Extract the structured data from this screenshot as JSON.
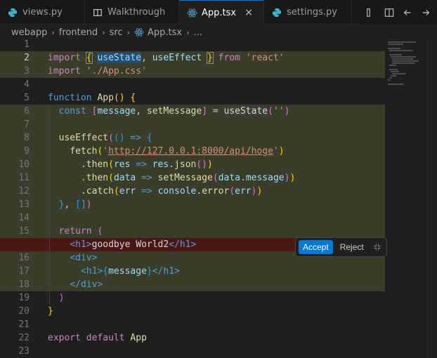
{
  "tabs": [
    {
      "label": "views.py",
      "icon": "python-icon"
    },
    {
      "label": "Walkthrough",
      "icon": "walkthrough-icon"
    },
    {
      "label": "App.tsx",
      "icon": "react-icon",
      "active": true,
      "close": "×"
    },
    {
      "label": "settings.py",
      "icon": "python-icon"
    }
  ],
  "breadcrumb": {
    "items": [
      "webapp",
      "frontend",
      "src",
      "App.tsx",
      "..."
    ]
  },
  "editor": {
    "line_numbers": [
      "1",
      "2",
      "3",
      "4",
      "5",
      "6",
      "7",
      "8",
      "9",
      "10",
      "11",
      "12",
      "13",
      "14",
      "15",
      "",
      "16",
      "17",
      "18",
      "19",
      "20",
      "21",
      "22",
      "23"
    ]
  },
  "inline_widget": {
    "accept_label": "Accept",
    "reject_label": "Reject"
  },
  "colors": {
    "accent": "#0078d4",
    "added_bg": "#3b3d2b",
    "removed_bg": "#4b1818"
  }
}
